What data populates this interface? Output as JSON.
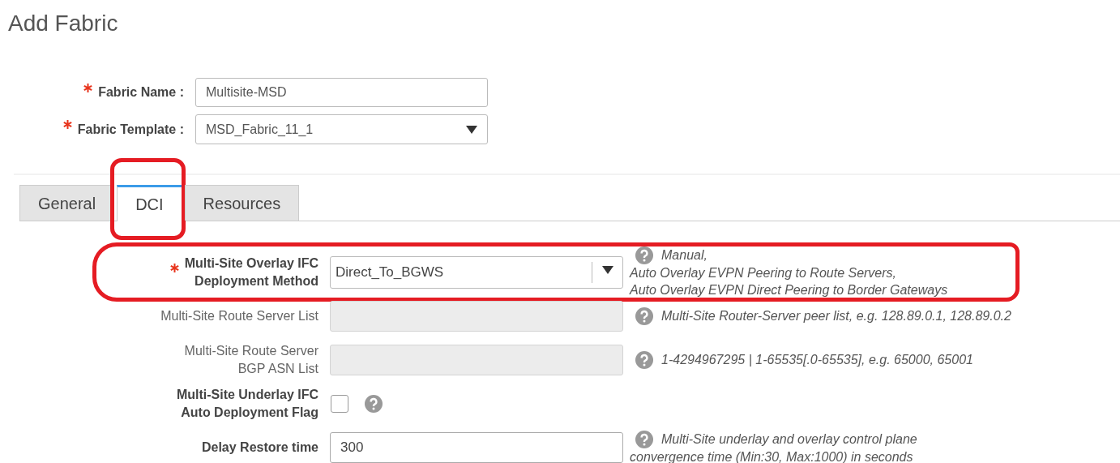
{
  "page": {
    "title": "Add Fabric"
  },
  "header_fields": [
    {
      "label": "Fabric Name :",
      "required": true,
      "kind": "text",
      "value": "Multisite-MSD"
    },
    {
      "label": "Fabric Template :",
      "required": true,
      "kind": "select",
      "value": "MSD_Fabric_11_1"
    }
  ],
  "tabs": [
    {
      "label": "General",
      "selected": false,
      "highlighted": false
    },
    {
      "label": "DCI",
      "selected": true,
      "highlighted": true
    },
    {
      "label": "Resources",
      "selected": false,
      "highlighted": false
    }
  ],
  "fields": [
    {
      "label": "Multi-Site Overlay IFC\nDeployment Method",
      "required": true,
      "disabled": false,
      "kind": "select",
      "value": "Direct_To_BGWS",
      "help_lines": [
        "Manual,",
        "Auto Overlay EVPN Peering to Route Servers,",
        "Auto Overlay EVPN Direct Peering to Border Gateways"
      ],
      "highlighted": true
    },
    {
      "label": "Multi-Site Route Server List",
      "required": false,
      "disabled": true,
      "kind": "text",
      "help_lines": [
        "Multi-Site Router-Server peer list, e.g. 128.89.0.1, 128.89.0.2"
      ],
      "highlighted": false
    },
    {
      "label": "Multi-Site Route Server\nBGP ASN List",
      "required": false,
      "disabled": true,
      "kind": "text",
      "help_lines": [
        "1-4294967295 | 1-65535[.0-65535], e.g. 65000, 65001"
      ],
      "highlighted": false
    },
    {
      "label": "Multi-Site Underlay IFC\nAuto Deployment Flag",
      "required": false,
      "disabled": false,
      "kind": "checkbox",
      "checked": false,
      "highlighted": false
    },
    {
      "label": "Delay Restore time",
      "required": false,
      "disabled": false,
      "kind": "text",
      "value": "300",
      "help_lines": [
        "Multi-Site underlay and overlay control plane",
        "convergence time (Min:30, Max:1000) in seconds"
      ],
      "highlighted": false
    }
  ]
}
